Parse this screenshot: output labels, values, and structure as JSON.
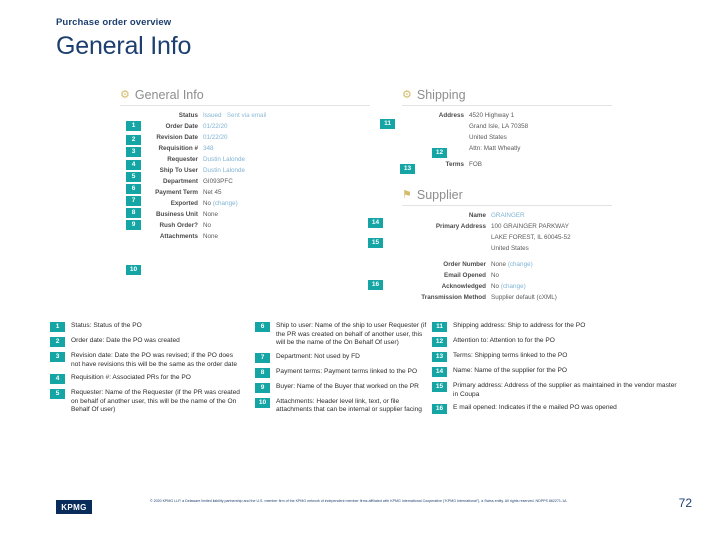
{
  "header": {
    "eyebrow": "Purchase order overview",
    "title": "General Info"
  },
  "screenshot": {
    "general_info": {
      "icon": "gear-icon",
      "panel_title": "General Info",
      "rows": [
        {
          "label": "Status",
          "value": "Issued",
          "extra": "Sent via email"
        },
        {
          "label": "Order Date",
          "value": "01/22/20",
          "extra": ""
        },
        {
          "label": "Revision Date",
          "value": "01/22/20",
          "extra": ""
        },
        {
          "label": "Requisition #",
          "value": "348",
          "extra": ""
        },
        {
          "label": "Requester",
          "value": "Dustin Lalonde",
          "extra": ""
        },
        {
          "label": "Ship To User",
          "value": "Dustin Lalonde",
          "extra": ""
        },
        {
          "label": "Department",
          "value": "GI093PFC",
          "extra": ""
        },
        {
          "label": "Payment Term",
          "value": "Net 45",
          "extra": ""
        },
        {
          "label": "Exported",
          "value": "No",
          "extra": "(change)"
        },
        {
          "label": "Business Unit",
          "value": "None",
          "extra": ""
        },
        {
          "label": "Rush Order?",
          "value": "No",
          "extra": ""
        },
        {
          "label": "Attachments",
          "value": "None",
          "extra": ""
        }
      ]
    },
    "shipping": {
      "icon": "gear-icon",
      "panel_title": "Shipping",
      "rows": [
        {
          "label": "Address",
          "value": "4520 Highway 1",
          "extra": ""
        },
        {
          "label": "",
          "value": "Grand Isle, LA 70358",
          "extra": ""
        },
        {
          "label": "",
          "value": "United States",
          "extra": ""
        },
        {
          "label": "",
          "value": "Attn: Matt Wheatly",
          "extra": ""
        },
        {
          "label": "Terms",
          "value": "FOB",
          "extra": ""
        }
      ]
    },
    "supplier": {
      "icon": "supplier-icon",
      "panel_title": "Supplier",
      "rows": [
        {
          "label": "Name",
          "value": "GRAINGER",
          "extra": ""
        },
        {
          "label": "Primary Address",
          "value": "100 GRAINGER PARKWAY",
          "extra": ""
        },
        {
          "label": "",
          "value": "LAKE FOREST, IL 60045-52",
          "extra": ""
        },
        {
          "label": "",
          "value": "United States",
          "extra": ""
        },
        {
          "label": "Order Number",
          "value": "None",
          "extra": "(change)"
        },
        {
          "label": "Email Opened",
          "value": "No",
          "extra": ""
        },
        {
          "label": "Acknowledged",
          "value": "No",
          "extra": "(change)"
        },
        {
          "label": "Transmission Method",
          "value": "Supplier default (cXML)",
          "extra": ""
        }
      ]
    },
    "callout_badges": [
      "1",
      "2",
      "3",
      "4",
      "5",
      "6",
      "7",
      "8",
      "9",
      "10",
      "11",
      "12",
      "13",
      "14",
      "15",
      "16"
    ]
  },
  "legend": {
    "column1": [
      {
        "num": "1",
        "text": "Status: Status of the PO"
      },
      {
        "num": "2",
        "text": "Order date: Date the PO was created"
      },
      {
        "num": "3",
        "text": "Revision date: Date the PO was revised; if the PO does not have revisions this will be the same as the order date"
      },
      {
        "num": "4",
        "text": "Requisition #: Associated PRs for the PO"
      },
      {
        "num": "5",
        "text": "Requester: Name of the Requester (if the PR was created on behalf of another user, this will be the name of the On Behalf Of user)"
      }
    ],
    "column2": [
      {
        "num": "6",
        "text": "Ship to user: Name of the ship to user Requester (if the PR was created on behalf of another user, this will be the name of the On Behalf Of user)"
      },
      {
        "num": "7",
        "text": "Department: Not used by FD"
      },
      {
        "num": "8",
        "text": "Payment terms: Payment terms linked to the PO"
      },
      {
        "num": "9",
        "text": "Buyer: Name of the Buyer that worked on the PR"
      },
      {
        "num": "10",
        "text": "Attachments: Header level link, text, or file attachments that can be internal or supplier facing"
      }
    ],
    "column3": [
      {
        "num": "11",
        "text": "Shipping address: Ship to address for the PO"
      },
      {
        "num": "12",
        "text": "Attention to: Attention to for the PO"
      },
      {
        "num": "13",
        "text": "Terms: Shipping terms linked to the PO"
      },
      {
        "num": "14",
        "text": "Name: Name of the supplier for the PO"
      },
      {
        "num": "15",
        "text": "Primary address: Address of the supplier as maintained in the vendor master in Coupa"
      },
      {
        "num": "16",
        "text": "E mail opened: Indicates if the e mailed PO was opened"
      }
    ]
  },
  "footer": {
    "logo_text": "KPMG",
    "disclaimer": "© 2020 KPMG LLP, a Delaware limited liability partnership and the U.S. member firm of the KPMG network of independent member firms affiliated with KPMG International Cooperative (\"KPMG International\"), a Swiss entity. All rights reserved. NDPPS 862271-1A",
    "page_number": "72"
  },
  "colors": {
    "brand_navy": "#1c3f70",
    "badge_teal": "#16a5a5",
    "value_blue": "#7fb3d3"
  }
}
